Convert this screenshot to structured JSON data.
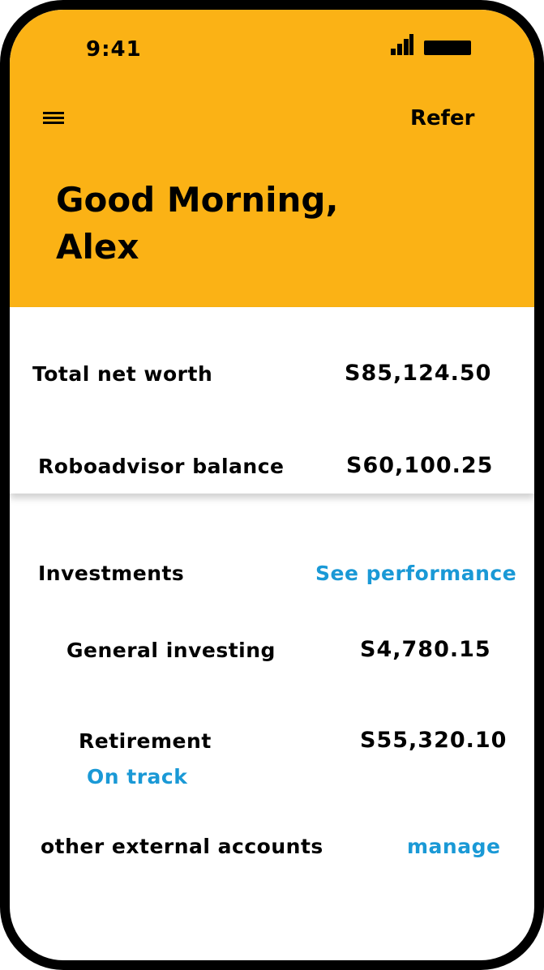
{
  "status_bar": {
    "time": "9:41",
    "signal_icon": "signal-bars-icon",
    "battery_icon": "battery-icon"
  },
  "header": {
    "menu_icon": "hamburger-menu-icon",
    "refer_label": "Refer",
    "greeting_line1": "Good Morning,",
    "greeting_line2": "Alex",
    "background_color": "#FBB215"
  },
  "summary": {
    "net_worth_label": "Total net worth",
    "net_worth_value": "S85,124.50",
    "robo_label": "Roboadvisor balance",
    "robo_value": "S60,100.25"
  },
  "investments": {
    "title": "Investments",
    "see_performance_label": "See performance",
    "general_label": "General investing",
    "general_value": "S4,780.15",
    "retirement_label": "Retirement",
    "retirement_value": "S55,320.10",
    "retirement_status": "On track",
    "external_label": "other external accounts",
    "manage_label": "manage",
    "link_color": "#1A99D6"
  }
}
